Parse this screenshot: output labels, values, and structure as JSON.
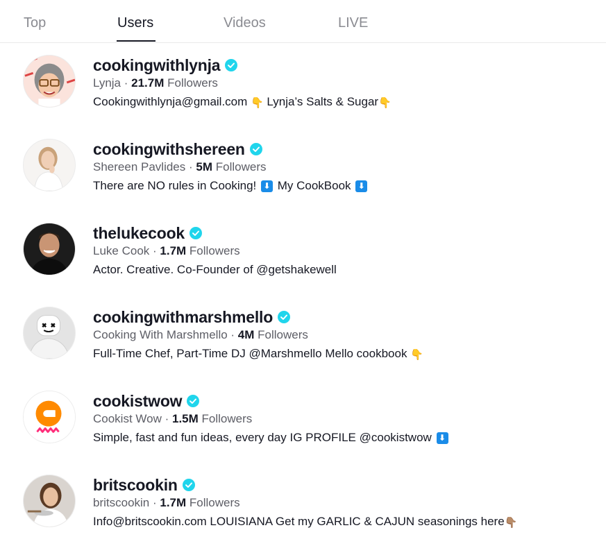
{
  "tabs": [
    {
      "label": "Top",
      "active": false
    },
    {
      "label": "Users",
      "active": true
    },
    {
      "label": "Videos",
      "active": false
    },
    {
      "label": "LIVE",
      "active": false
    }
  ],
  "icons": {
    "verified": "verified-badge-icon",
    "pointing_down": "👇",
    "pointing_down_dark": "👇🏽",
    "download_arrow": "⬇"
  },
  "colors": {
    "verified": "#20d5ec",
    "text_primary": "#161823",
    "text_secondary": "#5d5e66",
    "tab_inactive": "#8a8b91"
  },
  "users": [
    {
      "username": "cookingwithlynja",
      "display_name": "Lynja",
      "followers": "21.7M",
      "followers_label": "Followers",
      "separator": " · ",
      "bio_1": "Cookingwithlynja@gmail.com ",
      "bio_2": " Lynja’s Salts & Sugar"
    },
    {
      "username": "cookingwithshereen",
      "display_name": "Shereen Pavlides",
      "followers": "5M",
      "followers_label": "Followers",
      "separator": " · ",
      "bio_1": "There are NO rules in Cooking! ",
      "bio_2": " My CookBook "
    },
    {
      "username": "thelukecook",
      "display_name": "Luke Cook",
      "followers": "1.7M",
      "followers_label": "Followers",
      "separator": " · ",
      "bio_1": "Actor. Creative. Co-Founder of @getshakewell"
    },
    {
      "username": "cookingwithmarshmello",
      "display_name": "Cooking With Marshmello",
      "followers": "4M",
      "followers_label": "Followers",
      "separator": " · ",
      "bio_1": "Full-Time Chef, Part-Time DJ @Marshmello Mello cookbook "
    },
    {
      "username": "cookistwow",
      "display_name": "Cookist Wow",
      "followers": "1.5M",
      "followers_label": "Followers",
      "separator": " · ",
      "bio_1": "Simple, fast and fun ideas, every day IG PROFILE @cookistwow "
    },
    {
      "username": "britscookin",
      "display_name": "britscookin",
      "followers": "1.7M",
      "followers_label": "Followers",
      "separator": " · ",
      "bio_1": "Info@britscookin.com LOUISIANA Get my GARLIC & CAJUN seasonings here"
    }
  ]
}
